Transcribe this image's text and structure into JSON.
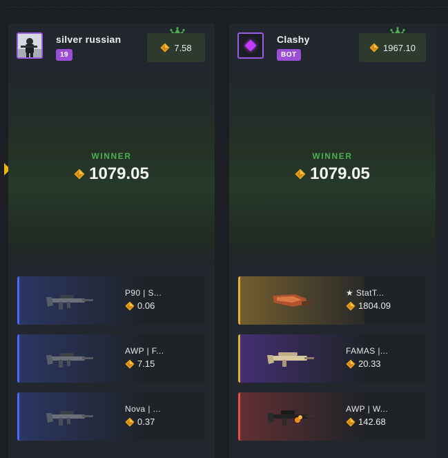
{
  "colors": {
    "accent_green": "#4caf50",
    "badge_purple": "#9b4fd6",
    "coin_gold": "#f0a520"
  },
  "players": [
    {
      "name": "silver russian",
      "badge": "19",
      "balance": "7.58",
      "winner_label": "WINNER",
      "winner_amount": "1079.05",
      "avatar": "user-photo",
      "items": [
        {
          "name": "P90 | S...",
          "price": "0.06",
          "rarity_color": "#4b69ff"
        },
        {
          "name": "AWP | F...",
          "price": "7.15",
          "rarity_color": "#4b69ff"
        },
        {
          "name": "Nova | ...",
          "price": "0.37",
          "rarity_color": "#4b69ff"
        }
      ]
    },
    {
      "name": "Clashy",
      "badge": "BOT",
      "balance": "1967.10",
      "winner_label": "WINNER",
      "winner_amount": "1079.05",
      "avatar": "gem-icon",
      "items": [
        {
          "name": "★ StatT...",
          "price": "1804.09",
          "rarity_color": "#e4ae39"
        },
        {
          "name": "FAMAS |...",
          "price": "20.33",
          "rarity_color": "#e4ae39"
        },
        {
          "name": "AWP | W...",
          "price": "142.68",
          "rarity_color": "#eb4b4b"
        }
      ]
    }
  ]
}
